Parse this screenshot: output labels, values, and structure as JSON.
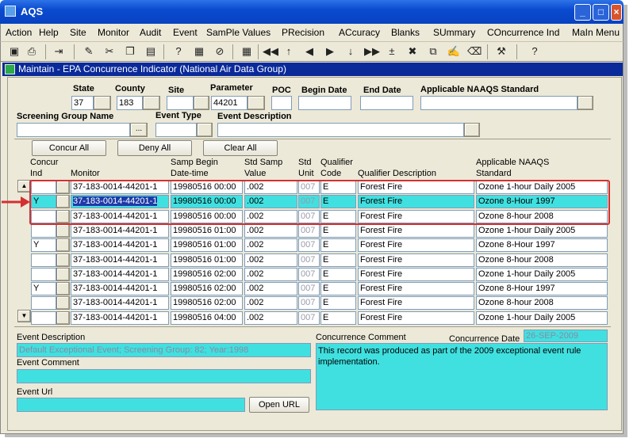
{
  "window": {
    "title": "AQS"
  },
  "menu": [
    "Action",
    "Help",
    "Site",
    "Monitor",
    "Audit",
    "Event",
    "SamPle Values",
    "PRecision",
    "ACcuracy",
    "Blanks",
    "SUmmary",
    "COncurrence Ind",
    "MaIn Menu"
  ],
  "form": {
    "title": "Maintain - EPA Concurrence Indicator (National Air Data Group)",
    "labels": {
      "state": "State",
      "county": "County",
      "site": "Site",
      "parameter": "Parameter",
      "poc": "POC",
      "begin_date": "Begin Date",
      "end_date": "End Date",
      "naaqs": "Applicable NAAQS Standard",
      "screening_group": "Screening Group Name",
      "event_type": "Event Type",
      "event_description": "Event Description"
    },
    "values": {
      "state": "37",
      "county": "183",
      "site": "",
      "parameter": "44201",
      "poc": "",
      "begin_date": "",
      "end_date": "",
      "naaqs": "",
      "screening_group": "",
      "event_type": "",
      "event_description": ""
    },
    "ellipsis": "..."
  },
  "buttons": {
    "concur_all": "Concur All",
    "deny_all": "Deny All",
    "clear_all": "Clear All",
    "open_url": "Open URL"
  },
  "columns": {
    "concur_ind_1": "Concur",
    "concur_ind_2": "Ind",
    "monitor": "Monitor",
    "begin_1": "Samp Begin",
    "begin_2": "Date-time",
    "value_1": "Std Samp",
    "value_2": "Value",
    "unit_1": "Std",
    "unit_2": "Unit",
    "qual_1": "Qualifier",
    "qual_2": "Code",
    "qual_desc": "Qualifier Description",
    "naaqs_1": "Applicable NAAQS",
    "naaqs_2": "Standard"
  },
  "rows": [
    {
      "ind": "",
      "monitor": "37-183-0014-44201-1",
      "begin": "19980516 00:00",
      "value": ".002",
      "unit": "007",
      "code": "E",
      "desc": "Forest Fire",
      "naaqs": "Ozone 1-hour Daily 2005"
    },
    {
      "ind": "Y",
      "monitor": "37-183-0014-44201-1",
      "begin": "19980516 00:00",
      "value": ".002",
      "unit": "007",
      "code": "E",
      "desc": "Forest Fire",
      "naaqs": "Ozone 8-Hour 1997"
    },
    {
      "ind": "",
      "monitor": "37-183-0014-44201-1",
      "begin": "19980516 00:00",
      "value": ".002",
      "unit": "007",
      "code": "E",
      "desc": "Forest Fire",
      "naaqs": "Ozone 8-hour 2008"
    },
    {
      "ind": "",
      "monitor": "37-183-0014-44201-1",
      "begin": "19980516 01:00",
      "value": ".002",
      "unit": "007",
      "code": "E",
      "desc": "Forest Fire",
      "naaqs": "Ozone 1-hour Daily 2005"
    },
    {
      "ind": "Y",
      "monitor": "37-183-0014-44201-1",
      "begin": "19980516 01:00",
      "value": ".002",
      "unit": "007",
      "code": "E",
      "desc": "Forest Fire",
      "naaqs": "Ozone 8-Hour 1997"
    },
    {
      "ind": "",
      "monitor": "37-183-0014-44201-1",
      "begin": "19980516 01:00",
      "value": ".002",
      "unit": "007",
      "code": "E",
      "desc": "Forest Fire",
      "naaqs": "Ozone 8-hour 2008"
    },
    {
      "ind": "",
      "monitor": "37-183-0014-44201-1",
      "begin": "19980516 02:00",
      "value": ".002",
      "unit": "007",
      "code": "E",
      "desc": "Forest Fire",
      "naaqs": "Ozone 1-hour Daily 2005"
    },
    {
      "ind": "Y",
      "monitor": "37-183-0014-44201-1",
      "begin": "19980516 02:00",
      "value": ".002",
      "unit": "007",
      "code": "E",
      "desc": "Forest Fire",
      "naaqs": "Ozone 8-Hour 1997"
    },
    {
      "ind": "",
      "monitor": "37-183-0014-44201-1",
      "begin": "19980516 02:00",
      "value": ".002",
      "unit": "007",
      "code": "E",
      "desc": "Forest Fire",
      "naaqs": "Ozone 8-hour 2008"
    },
    {
      "ind": "",
      "monitor": "37-183-0014-44201-1",
      "begin": "19980516 04:00",
      "value": ".002",
      "unit": "007",
      "code": "E",
      "desc": "Forest Fire",
      "naaqs": "Ozone 1-hour Daily 2005"
    }
  ],
  "details": {
    "event_description_label": "Event Description",
    "event_description": "Default Exceptional Event; Screening Group: 82; Year:1998",
    "event_comment_label": "Event Comment",
    "event_comment": "",
    "event_url_label": "Event Url",
    "event_url": "",
    "concurrence_comment_label": "Concurrence Comment",
    "concurrence_date_label": "Concurrence Date",
    "concurrence_date": "26-SEP-2009",
    "concurrence_comment": "This record was produced as part of the 2009 exceptional event rule implementation."
  },
  "colors": {
    "accent_selected": "#40e0e0",
    "highlight": "#d43030",
    "title_bar": "#0a4bd0"
  },
  "icons": [
    "save-icon",
    "print-icon",
    "exit-icon",
    "cut-icon",
    "scissors-icon",
    "copy-icon",
    "paste-icon",
    "query-icon",
    "execute-query-icon",
    "cancel-query-icon",
    "grid-icon",
    "first-record-icon",
    "up-icon",
    "previous-record-icon",
    "next-record-icon",
    "down-icon",
    "last-record-icon",
    "insert-record-icon",
    "delete-record-icon",
    "duplicate-icon",
    "edit-icon",
    "clear-icon",
    "lov-icon",
    "help-icon"
  ]
}
